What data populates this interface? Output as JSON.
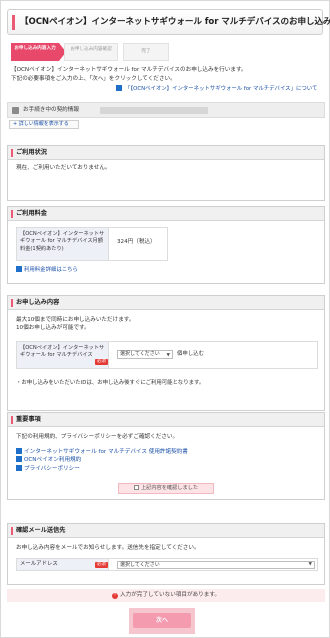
{
  "header": {
    "title": "【OCNペイオン】インターネットサギウォール for マルチデバイスのお申し込み"
  },
  "steps": [
    {
      "label": "お申し込み内容入力"
    },
    {
      "label": "お申し込み内容確認"
    },
    {
      "label": "完了"
    }
  ],
  "intro": {
    "line1": "【OCNペイオン】インターネットサギウォール for マルチデバイスのお申し込みを行います。",
    "line2": "下記の必要事項をご入力の上、「次へ」をクリックしてください。"
  },
  "info_link": "「【OCNペイオン】インターネットサギウォール for マルチデバイス」について",
  "contract": {
    "label": "お手続き中の契約情報"
  },
  "detail_link": "詳しい情報を表示する",
  "usage": {
    "title": "ご利用状況",
    "text": "現在、ご利用いただいておりません。"
  },
  "fee": {
    "title": "ご利用料金",
    "name": "【OCNペイオン】インターネットサギウォール for マルチデバイス月額料金(1契約あたり)",
    "value": "324円（税込）",
    "link": "利用料金詳細はこちら"
  },
  "apply": {
    "title": "お申し込み内容",
    "intro1": "最大10個まで同時にお申し込みいただけます。",
    "intro2": "10個お申し込みが可能です。",
    "name": "【OCNペイオン】インターネットサギウォール for マルチデバイス",
    "required": "必須",
    "select_placeholder": "選択してください",
    "unit": "個申し込む",
    "note": "・お申し込みをいただいたIDは、お申し込み後すぐにご利用可能となります。"
  },
  "important": {
    "title": "重要事項",
    "intro": "下記の利用規約、プライバシーポリシーを必ずご確認ください。",
    "links": [
      "インターネットサギウォール for マルチデバイス 使用許諾契約書",
      "OCNペイオン利用規約",
      "プライバシーポリシー"
    ],
    "confirm": "上記内容を確認しました"
  },
  "mail": {
    "title": "確認メール送信先",
    "intro": "お申し込み内容をメールでお知らせします。送信先を指定してください。",
    "label": "メールアドレス",
    "required": "必須",
    "select_placeholder": "選択してください"
  },
  "error": {
    "text": "入力が完了していない項目があります。"
  },
  "next_button": "次へ"
}
